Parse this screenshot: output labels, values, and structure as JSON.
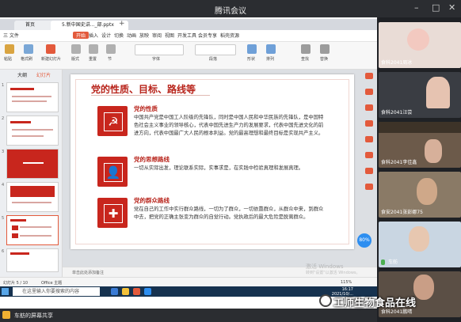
{
  "window": {
    "title": "腾讯会议"
  },
  "browser_tabs": [
    {
      "label": "首页"
    },
    {
      "label": "5.新中国史讲..._部.pptx",
      "active": true
    }
  ],
  "app": {
    "menu": [
      "三 文件",
      "开始",
      "插入",
      "设计",
      "切换",
      "动画",
      "放映",
      "审阅",
      "视图",
      "开发工具",
      "会员专享",
      "稻壳资源"
    ],
    "menu_selected": "开始",
    "ribbon": [
      "粘贴",
      "格式刷",
      "新建幻灯片",
      "版式",
      "重置",
      "节",
      "字体",
      "段落",
      "形状",
      "排列",
      "查找",
      "替换"
    ]
  },
  "thumbnails": {
    "tabs": [
      "大纲",
      "幻灯片"
    ],
    "numbers": [
      "1",
      "2",
      "3",
      "4",
      "5",
      "6"
    ]
  },
  "slide": {
    "title": "党的性质、目标、路线等",
    "blocks": [
      {
        "icon": "party-emblem-icon",
        "heading": "党的性质",
        "body": "中国共产党是中国工人阶级的先锋队，同时是中国人民和中华民族的先锋队，是中国特色社会主义事业的领导核心，代表中国先进生产力的发展要求，代表中国先进文化的前进方向，代表中国最广大人民的根本利益。党的最高理想和最终目标是实现共产主义。"
      },
      {
        "icon": "people-icon",
        "heading": "党的思想路线",
        "body": "一切从实际出发，理论联系实际，实事求是，在实践中检验真理和发展真理。"
      },
      {
        "icon": "heart-plus-icon",
        "heading": "党的群众路线",
        "body": "党在自己的工作中实行群众路线，一切为了群众，一切依靠群众，从群众中来，到群众中去，把党的正确主张变为群众的自觉行动。党执政后的最大危险是脱离群众。"
      }
    ]
  },
  "notes": {
    "placeholder": "单击此处添加备注"
  },
  "status_bar": {
    "slide_count": "幻灯片 5 / 10",
    "theme": "Office 主题",
    "zoom": "115%"
  },
  "taskbar": {
    "search_placeholder": "在这里输入你要搜索的内容",
    "time": "16:17",
    "date": "2021/10/..."
  },
  "windows_watermark": {
    "line1": "激活 Windows",
    "line2": "转到\"设置\"以激活 Windows。"
  },
  "speed_badge": "80%",
  "share_banner": {
    "label": "车舫的屏幕共享"
  },
  "participants": [
    {
      "name": "食科2041周冰",
      "bg": "#e9dcd6"
    },
    {
      "name": "食科2041汪尝",
      "bg": "#3a3d43"
    },
    {
      "name": "食科2041李佳鑫",
      "bg": "#6c5a4a"
    },
    {
      "name": "食安2041张彭娜75",
      "bg": "#8a7a66"
    },
    {
      "name": "车舫",
      "bg": "#c9d6e2"
    },
    {
      "name": "食科2041鹏晴",
      "bg": "#5b4f45"
    }
  ],
  "brand_watermark": "工师生物食品在线",
  "colors": {
    "accent": "#c8261d",
    "wps_orange": "#e35a3c"
  }
}
